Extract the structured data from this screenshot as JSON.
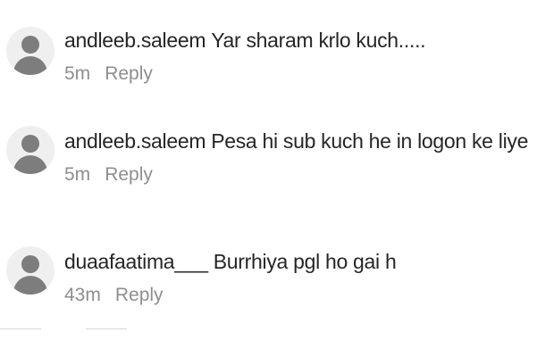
{
  "comments": [
    {
      "username": "andleeb.saleem",
      "text": "Yar sharam krlo kuch.....",
      "time": "5m",
      "reply": "Reply"
    },
    {
      "username": "andleeb.saleem",
      "text": "Pesa hi sub kuch he in logon ke liye",
      "time": "5m",
      "reply": "Reply"
    },
    {
      "username": "duaafaatima___",
      "text": "Burrhiya pgl ho gai h",
      "time": "43m",
      "reply": "Reply"
    }
  ]
}
